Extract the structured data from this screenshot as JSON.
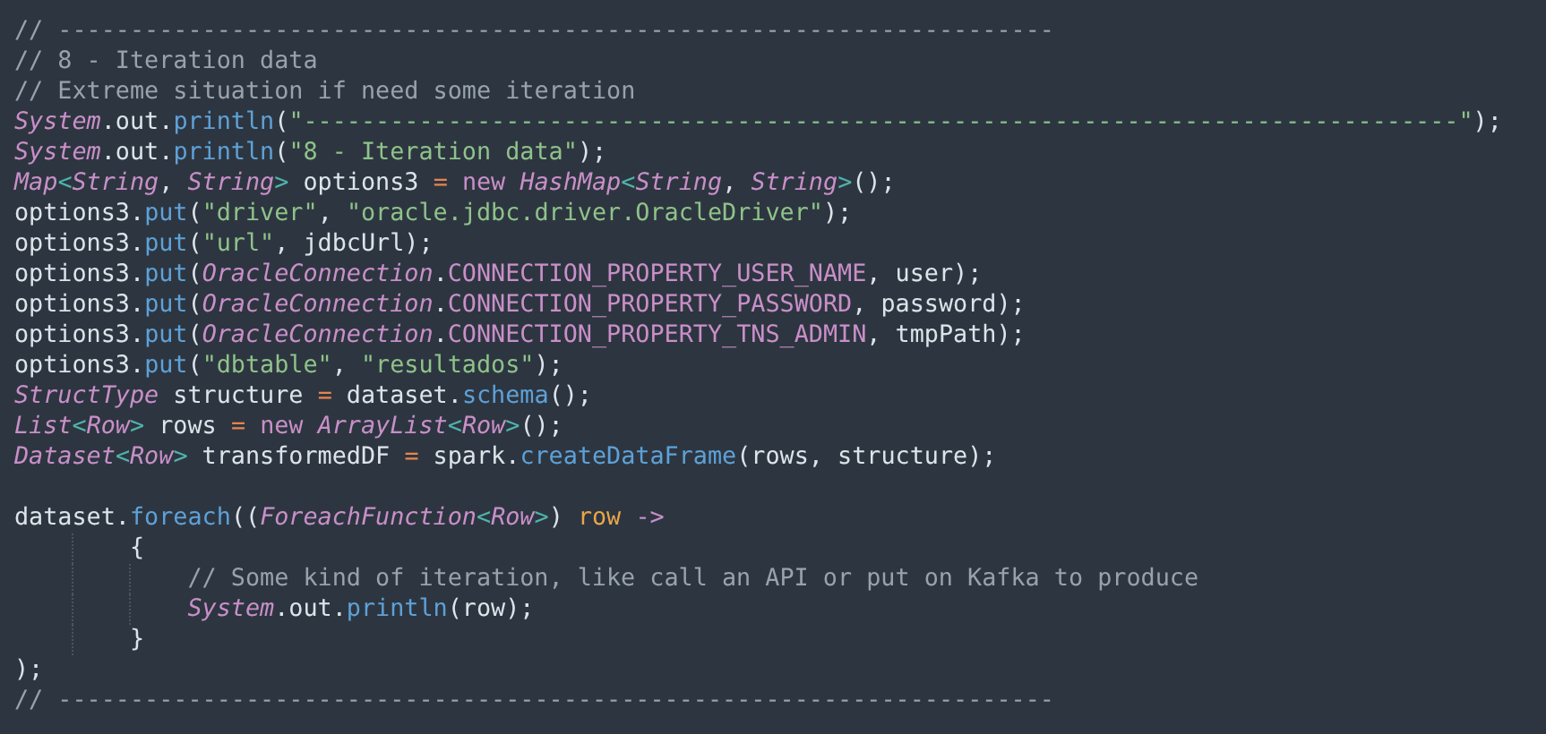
{
  "editor": {
    "lines": [
      {
        "kind": "code",
        "tokens": [
          {
            "kind": "comment",
            "text": "// ---------------------------------------------------------------------"
          }
        ]
      },
      {
        "kind": "code",
        "tokens": [
          {
            "kind": "comment",
            "text": "// 8 - Iteration data"
          }
        ]
      },
      {
        "kind": "code",
        "tokens": [
          {
            "kind": "comment",
            "text": "// Extreme situation if need some iteration"
          }
        ]
      },
      {
        "kind": "code",
        "tokens": [
          {
            "kind": "type",
            "text": "System"
          },
          {
            "kind": "plain",
            "text": ".out."
          },
          {
            "kind": "method",
            "text": "println"
          },
          {
            "kind": "plain",
            "text": "("
          },
          {
            "kind": "string",
            "text": "\"--------------------------------------------------------------------------------\""
          },
          {
            "kind": "plain",
            "text": ");"
          }
        ]
      },
      {
        "kind": "code",
        "tokens": [
          {
            "kind": "type",
            "text": "System"
          },
          {
            "kind": "plain",
            "text": ".out."
          },
          {
            "kind": "method",
            "text": "println"
          },
          {
            "kind": "plain",
            "text": "("
          },
          {
            "kind": "string",
            "text": "\"8 - Iteration data\""
          },
          {
            "kind": "plain",
            "text": ");"
          }
        ]
      },
      {
        "kind": "code",
        "tokens": [
          {
            "kind": "type",
            "text": "Map"
          },
          {
            "kind": "bracket",
            "text": "<"
          },
          {
            "kind": "type",
            "text": "String"
          },
          {
            "kind": "plain",
            "text": ", "
          },
          {
            "kind": "type",
            "text": "String"
          },
          {
            "kind": "bracket",
            "text": ">"
          },
          {
            "kind": "plain",
            "text": " options3 "
          },
          {
            "kind": "operator",
            "text": "= "
          },
          {
            "kind": "keyword",
            "text": "new "
          },
          {
            "kind": "type",
            "text": "HashMap"
          },
          {
            "kind": "bracket",
            "text": "<"
          },
          {
            "kind": "type",
            "text": "String"
          },
          {
            "kind": "plain",
            "text": ", "
          },
          {
            "kind": "type",
            "text": "String"
          },
          {
            "kind": "bracket",
            "text": ">"
          },
          {
            "kind": "plain",
            "text": "();"
          }
        ]
      },
      {
        "kind": "code",
        "tokens": [
          {
            "kind": "plain",
            "text": "options3."
          },
          {
            "kind": "method",
            "text": "put"
          },
          {
            "kind": "plain",
            "text": "("
          },
          {
            "kind": "string",
            "text": "\"driver\""
          },
          {
            "kind": "plain",
            "text": ", "
          },
          {
            "kind": "string",
            "text": "\"oracle.jdbc.driver.OracleDriver\""
          },
          {
            "kind": "plain",
            "text": ");"
          }
        ]
      },
      {
        "kind": "code",
        "tokens": [
          {
            "kind": "plain",
            "text": "options3."
          },
          {
            "kind": "method",
            "text": "put"
          },
          {
            "kind": "plain",
            "text": "("
          },
          {
            "kind": "string",
            "text": "\"url\""
          },
          {
            "kind": "plain",
            "text": ", jdbcUrl);"
          }
        ]
      },
      {
        "kind": "code",
        "tokens": [
          {
            "kind": "plain",
            "text": "options3."
          },
          {
            "kind": "method",
            "text": "put"
          },
          {
            "kind": "plain",
            "text": "("
          },
          {
            "kind": "type",
            "text": "OracleConnection"
          },
          {
            "kind": "plain",
            "text": "."
          },
          {
            "kind": "constant",
            "text": "CONNECTION_PROPERTY_USER_NAME"
          },
          {
            "kind": "plain",
            "text": ", user);"
          }
        ]
      },
      {
        "kind": "code",
        "tokens": [
          {
            "kind": "plain",
            "text": "options3."
          },
          {
            "kind": "method",
            "text": "put"
          },
          {
            "kind": "plain",
            "text": "("
          },
          {
            "kind": "type",
            "text": "OracleConnection"
          },
          {
            "kind": "plain",
            "text": "."
          },
          {
            "kind": "constant",
            "text": "CONNECTION_PROPERTY_PASSWORD"
          },
          {
            "kind": "plain",
            "text": ", password);"
          }
        ]
      },
      {
        "kind": "code",
        "tokens": [
          {
            "kind": "plain",
            "text": "options3."
          },
          {
            "kind": "method",
            "text": "put"
          },
          {
            "kind": "plain",
            "text": "("
          },
          {
            "kind": "type",
            "text": "OracleConnection"
          },
          {
            "kind": "plain",
            "text": "."
          },
          {
            "kind": "constant",
            "text": "CONNECTION_PROPERTY_TNS_ADMIN"
          },
          {
            "kind": "plain",
            "text": ", tmpPath);"
          }
        ]
      },
      {
        "kind": "code",
        "tokens": [
          {
            "kind": "plain",
            "text": "options3."
          },
          {
            "kind": "method",
            "text": "put"
          },
          {
            "kind": "plain",
            "text": "("
          },
          {
            "kind": "string",
            "text": "\"dbtable\""
          },
          {
            "kind": "plain",
            "text": ", "
          },
          {
            "kind": "string",
            "text": "\"resultados\""
          },
          {
            "kind": "plain",
            "text": ");"
          }
        ]
      },
      {
        "kind": "code",
        "tokens": [
          {
            "kind": "type",
            "text": "StructType"
          },
          {
            "kind": "plain",
            "text": " structure "
          },
          {
            "kind": "operator",
            "text": "="
          },
          {
            "kind": "plain",
            "text": " dataset."
          },
          {
            "kind": "method",
            "text": "schema"
          },
          {
            "kind": "plain",
            "text": "();"
          }
        ]
      },
      {
        "kind": "code",
        "tokens": [
          {
            "kind": "type",
            "text": "List"
          },
          {
            "kind": "bracket",
            "text": "<"
          },
          {
            "kind": "type",
            "text": "Row"
          },
          {
            "kind": "bracket",
            "text": ">"
          },
          {
            "kind": "plain",
            "text": " rows "
          },
          {
            "kind": "operator",
            "text": "= "
          },
          {
            "kind": "keyword",
            "text": "new "
          },
          {
            "kind": "type",
            "text": "ArrayList"
          },
          {
            "kind": "bracket",
            "text": "<"
          },
          {
            "kind": "type",
            "text": "Row"
          },
          {
            "kind": "bracket",
            "text": ">"
          },
          {
            "kind": "plain",
            "text": "();"
          }
        ]
      },
      {
        "kind": "code",
        "tokens": [
          {
            "kind": "type",
            "text": "Dataset"
          },
          {
            "kind": "bracket",
            "text": "<"
          },
          {
            "kind": "type",
            "text": "Row"
          },
          {
            "kind": "bracket",
            "text": ">"
          },
          {
            "kind": "plain",
            "text": " transformedDF "
          },
          {
            "kind": "operator",
            "text": "="
          },
          {
            "kind": "plain",
            "text": " spark."
          },
          {
            "kind": "method",
            "text": "createDataFrame"
          },
          {
            "kind": "plain",
            "text": "(rows, structure);"
          }
        ]
      },
      {
        "kind": "blank"
      },
      {
        "kind": "code",
        "tokens": [
          {
            "kind": "plain",
            "text": "dataset."
          },
          {
            "kind": "method",
            "text": "foreach"
          },
          {
            "kind": "plain",
            "text": "(("
          },
          {
            "kind": "type",
            "text": "ForeachFunction"
          },
          {
            "kind": "bracket",
            "text": "<"
          },
          {
            "kind": "type",
            "text": "Row"
          },
          {
            "kind": "bracket",
            "text": ">"
          },
          {
            "kind": "plain",
            "text": ") "
          },
          {
            "kind": "param",
            "text": "row "
          },
          {
            "kind": "keyword",
            "text": "->"
          }
        ]
      },
      {
        "kind": "code",
        "tokens": [
          {
            "kind": "plain",
            "text": "        {"
          }
        ]
      },
      {
        "kind": "code",
        "tokens": [
          {
            "kind": "comment",
            "text": "            // Some kind of iteration, like call an API or put on Kafka to produce"
          }
        ]
      },
      {
        "kind": "code",
        "tokens": [
          {
            "kind": "type",
            "text": "            System"
          },
          {
            "kind": "plain",
            "text": ".out."
          },
          {
            "kind": "method",
            "text": "println"
          },
          {
            "kind": "plain",
            "text": "(row);"
          }
        ]
      },
      {
        "kind": "code",
        "tokens": [
          {
            "kind": "plain",
            "text": "        }"
          }
        ]
      },
      {
        "kind": "code",
        "tokens": [
          {
            "kind": "plain",
            "text": ");"
          }
        ]
      },
      {
        "kind": "code",
        "tokens": [
          {
            "kind": "comment",
            "text": "// ---------------------------------------------------------------------"
          }
        ]
      }
    ]
  }
}
